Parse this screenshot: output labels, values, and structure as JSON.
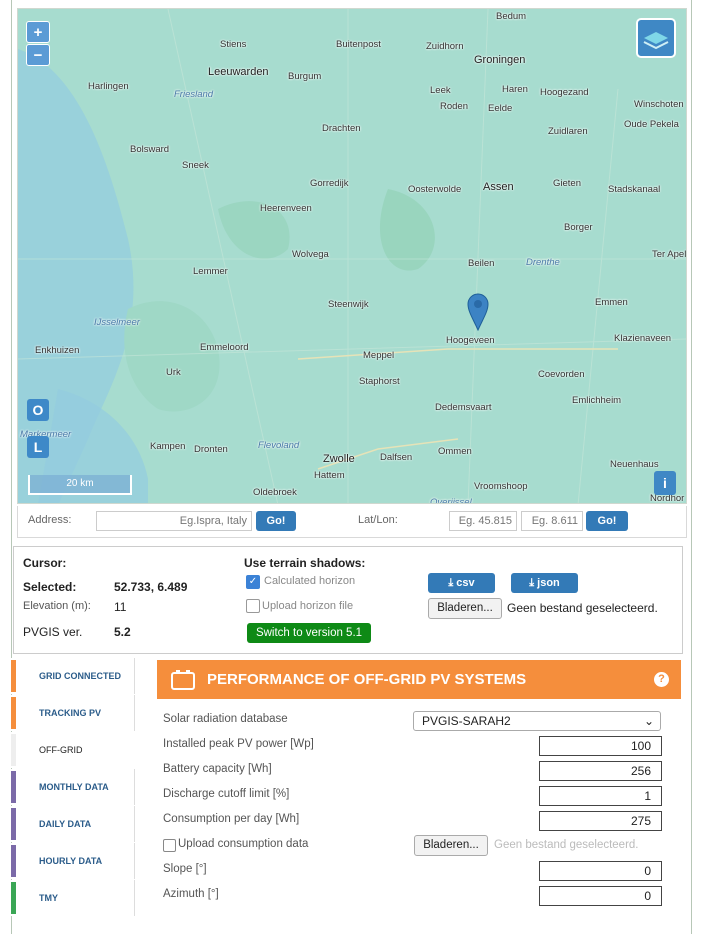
{
  "map": {
    "places": [
      {
        "label": "Bedum",
        "cls": ""
      },
      {
        "label": "Stiens",
        "cls": ""
      },
      {
        "label": "Buitenpost",
        "cls": ""
      },
      {
        "label": "Zuidhorn",
        "cls": ""
      },
      {
        "label": "Leeuwarden",
        "cls": "big"
      },
      {
        "label": "Burgum",
        "cls": ""
      },
      {
        "label": "Groningen",
        "cls": "big"
      },
      {
        "label": "Harlingen",
        "cls": ""
      },
      {
        "label": "Friesland",
        "cls": "region"
      },
      {
        "label": "Leek",
        "cls": ""
      },
      {
        "label": "Haren",
        "cls": ""
      },
      {
        "label": "Hoogezand",
        "cls": ""
      },
      {
        "label": "Roden",
        "cls": ""
      },
      {
        "label": "Eelde",
        "cls": ""
      },
      {
        "label": "Winschoten",
        "cls": ""
      },
      {
        "label": "Oude Pekela",
        "cls": ""
      },
      {
        "label": "Bolsward",
        "cls": ""
      },
      {
        "label": "Drachten",
        "cls": ""
      },
      {
        "label": "Zuidlaren",
        "cls": ""
      },
      {
        "label": "Sneek",
        "cls": ""
      },
      {
        "label": "Gorredijk",
        "cls": ""
      },
      {
        "label": "Oosterwolde",
        "cls": ""
      },
      {
        "label": "Assen",
        "cls": "big"
      },
      {
        "label": "Gieten",
        "cls": ""
      },
      {
        "label": "Stadskanaal",
        "cls": ""
      },
      {
        "label": "Heerenveen",
        "cls": ""
      },
      {
        "label": "Borger",
        "cls": ""
      },
      {
        "label": "Wolvega",
        "cls": ""
      },
      {
        "label": "Beilen",
        "cls": ""
      },
      {
        "label": "Drenthe",
        "cls": "region"
      },
      {
        "label": "Ter Apel",
        "cls": ""
      },
      {
        "label": "Lemmer",
        "cls": ""
      },
      {
        "label": "Steenwijk",
        "cls": ""
      },
      {
        "label": "Emmen",
        "cls": ""
      },
      {
        "label": "IJsselmeer",
        "cls": "region"
      },
      {
        "label": "Hoogeveen",
        "cls": ""
      },
      {
        "label": "Klazienaveen",
        "cls": ""
      },
      {
        "label": "Enkhuizen",
        "cls": ""
      },
      {
        "label": "Emmeloord",
        "cls": ""
      },
      {
        "label": "Meppel",
        "cls": ""
      },
      {
        "label": "Urk",
        "cls": ""
      },
      {
        "label": "Staphorst",
        "cls": ""
      },
      {
        "label": "Coevorden",
        "cls": ""
      },
      {
        "label": "Emlichheim",
        "cls": ""
      },
      {
        "label": "Dedemsvaart",
        "cls": ""
      },
      {
        "label": "Markermeer",
        "cls": "region"
      },
      {
        "label": "Kampen",
        "cls": ""
      },
      {
        "label": "Flevoland",
        "cls": "region"
      },
      {
        "label": "Dronten",
        "cls": ""
      },
      {
        "label": "Zwolle",
        "cls": "big"
      },
      {
        "label": "Dalfsen",
        "cls": ""
      },
      {
        "label": "Ommen",
        "cls": ""
      },
      {
        "label": "Neuenhaus",
        "cls": ""
      },
      {
        "label": "Hattem",
        "cls": ""
      },
      {
        "label": "Vroomshoop",
        "cls": ""
      },
      {
        "label": "Oldebroek",
        "cls": ""
      },
      {
        "label": "Overijssel",
        "cls": "region"
      },
      {
        "label": "Nordhor",
        "cls": ""
      }
    ],
    "zoom_in": "+",
    "zoom_out": "−",
    "btn_o": "O",
    "btn_l": "L",
    "btn_info": "i",
    "scale": "20 km",
    "marker": {
      "lat": 52.733,
      "lon": 6.489
    }
  },
  "address": {
    "label": "Address:",
    "placeholder": "Eg.Ispra, Italy",
    "go": "Go!",
    "latlon_label": "Lat/Lon:",
    "lat_placeholder": "Eg. 45.815",
    "lon_placeholder": "Eg. 8.611",
    "go2": "Go!"
  },
  "info": {
    "cursor_label": "Cursor:",
    "selected_label": "Selected:",
    "selected_value": "52.733, 6.489",
    "elevation_label": "Elevation (m):",
    "elevation_value": "11",
    "pvgis_label": "PVGIS ver.",
    "pvgis_value": "5.2",
    "terrain_title": "Use terrain shadows:",
    "calc_horizon": "Calculated horizon",
    "upload_horizon": "Upload horizon file",
    "switch": "Switch to version 5.1",
    "csv": "csv",
    "json": "json",
    "browse": "Bladeren...",
    "no_file": "Geen bestand geselecteerd."
  },
  "tabs": [
    {
      "label": "GRID CONNECTED",
      "color": "#f58e3c"
    },
    {
      "label": "TRACKING PV",
      "color": "#f58e3c"
    },
    {
      "label": "OFF-GRID",
      "color": "#eeeeee"
    },
    {
      "label": "MONTHLY DATA",
      "color": "#7b6aa8"
    },
    {
      "label": "DAILY DATA",
      "color": "#7b6aa8"
    },
    {
      "label": "HOURLY DATA",
      "color": "#7b6aa8"
    },
    {
      "label": "TMY",
      "color": "#3aa655"
    }
  ],
  "offgrid": {
    "title": "PERFORMANCE OF OFF-GRID PV SYSTEMS",
    "help": "?",
    "db_label": "Solar radiation database",
    "db_value": "PVGIS-SARAH2",
    "peak_label": "Installed peak PV power [Wp]",
    "peak_value": "100",
    "battery_label": "Battery capacity [Wh]",
    "battery_value": "256",
    "discharge_label": "Discharge cutoff limit [%]",
    "discharge_value": "1",
    "consumption_label": "Consumption per day [Wh]",
    "consumption_value": "275",
    "upload_label": "Upload consumption data",
    "browse": "Bladeren...",
    "no_file": "Geen bestand geselecteerd.",
    "slope_label": "Slope [°]",
    "slope_value": "0",
    "azimuth_label": "Azimuth [°]",
    "azimuth_value": "0"
  },
  "colors": {
    "accent": "#f58e3c",
    "blue": "#337ab7",
    "green": "#0e8a16"
  }
}
